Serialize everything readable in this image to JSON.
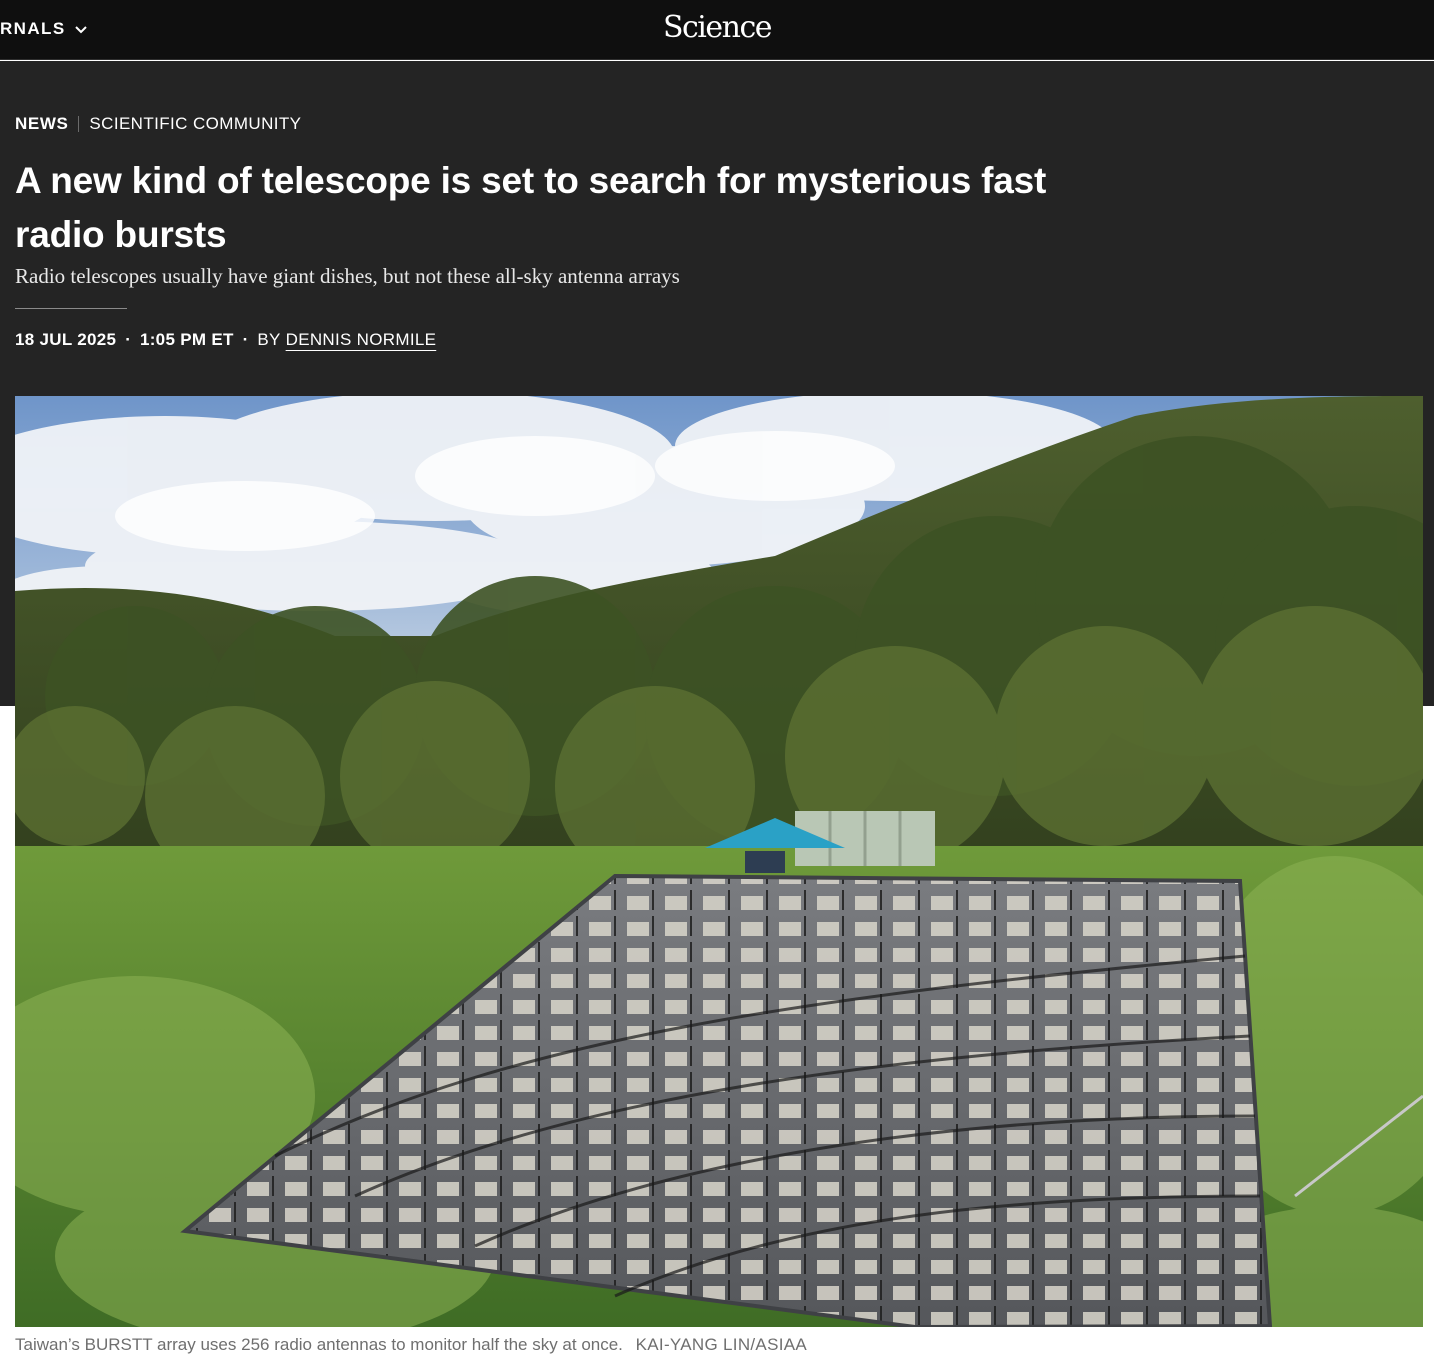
{
  "header": {
    "journals_label": "RNALS",
    "logo_text": "Science"
  },
  "article": {
    "kicker_section": "NEWS",
    "kicker_category": "SCIENTIFIC COMMUNITY",
    "headline_line1": "A new kind of telescope is set to search for mysterious fast",
    "headline_line2": "radio bursts",
    "dek": "Radio telescopes usually have giant dishes, but not these all-sky antenna arrays",
    "date": "18 JUL 2025",
    "time": "1:05 PM ET",
    "by": "BY",
    "author": "DENNIS NORMILE"
  },
  "photo": {
    "caption": "Taiwan’s BURSTT array uses 256 radio antennas to monitor half the sky at once.",
    "credit": "KAI-YANG LIN/ASIAA"
  },
  "colors": {
    "topbar": "#0f0f0f",
    "hero": "#242424",
    "text": "#ffffff",
    "caption": "#6f6f6f"
  },
  "icons": {
    "journals_dropdown": "chevron-down-icon"
  }
}
